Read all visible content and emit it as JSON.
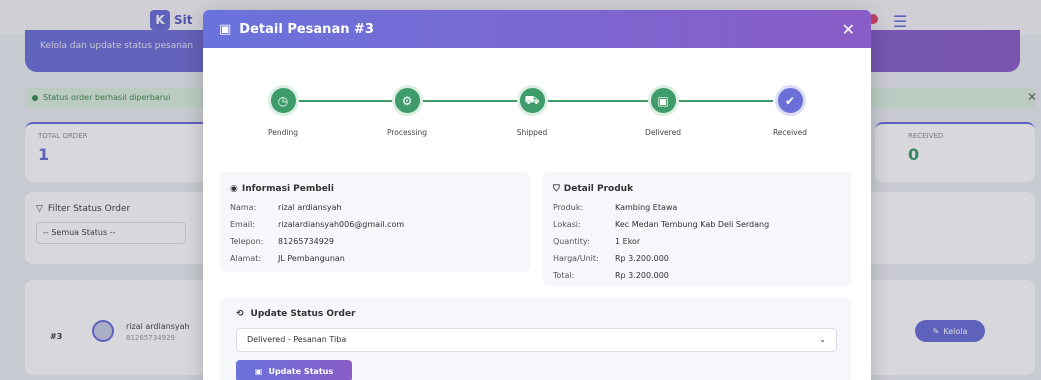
{
  "background": {
    "logo_letter": "K",
    "logo_text": "Sit",
    "hero_text": "Kelola dan update status pesanan",
    "alert_text": "Status order berhasil diperbarui",
    "cards": {
      "total_label": "TOTAL ORDER",
      "total_value": "1",
      "received_label": "RECEIVED",
      "received_value": "0"
    },
    "filter_title": "Filter Status Order",
    "filter_value": "-- Semua Status --",
    "row": {
      "id": "#3",
      "name": "rizal ardiansyah",
      "phone": "81265734929",
      "action": "Kelola"
    }
  },
  "modal": {
    "title": "Detail Pesanan #3",
    "steps": [
      {
        "label": "Pending",
        "icon": "clock-icon"
      },
      {
        "label": "Processing",
        "icon": "gear-icon"
      },
      {
        "label": "Shipped",
        "icon": "truck-icon"
      },
      {
        "label": "Delivered",
        "icon": "box-icon"
      },
      {
        "label": "Received",
        "icon": "check-icon"
      }
    ],
    "buyer": {
      "title": "Informasi Pembeli",
      "nama_label": "Nama:",
      "nama": "rizal ardiansyah",
      "email_label": "Email:",
      "email": "rizalardiansyah006@gmail.com",
      "telepon_label": "Telepon:",
      "telepon": "81265734929",
      "alamat_label": "Alamat:",
      "alamat": "JL Pembangunan"
    },
    "product": {
      "title": "Detail Produk",
      "produk_label": "Produk:",
      "produk": "Kambing Etawa",
      "lokasi_label": "Lokasi:",
      "lokasi": "Kec Medan Tembung Kab Deli Serdang",
      "quantity_label": "Quantity:",
      "quantity": "1 Ekor",
      "harga_label": "Harga/Unit:",
      "harga": "Rp 3.200.000",
      "total_label": "Total:",
      "total": "Rp 3.200.000"
    },
    "update": {
      "title": "Update Status Order",
      "selected": "Delivered - Pesanan Tiba",
      "button": "Update Status"
    }
  },
  "colors": {
    "accent": "#6b6fd8",
    "success": "#3e9b6a",
    "header_gradient_end": "#8a5cc7"
  }
}
